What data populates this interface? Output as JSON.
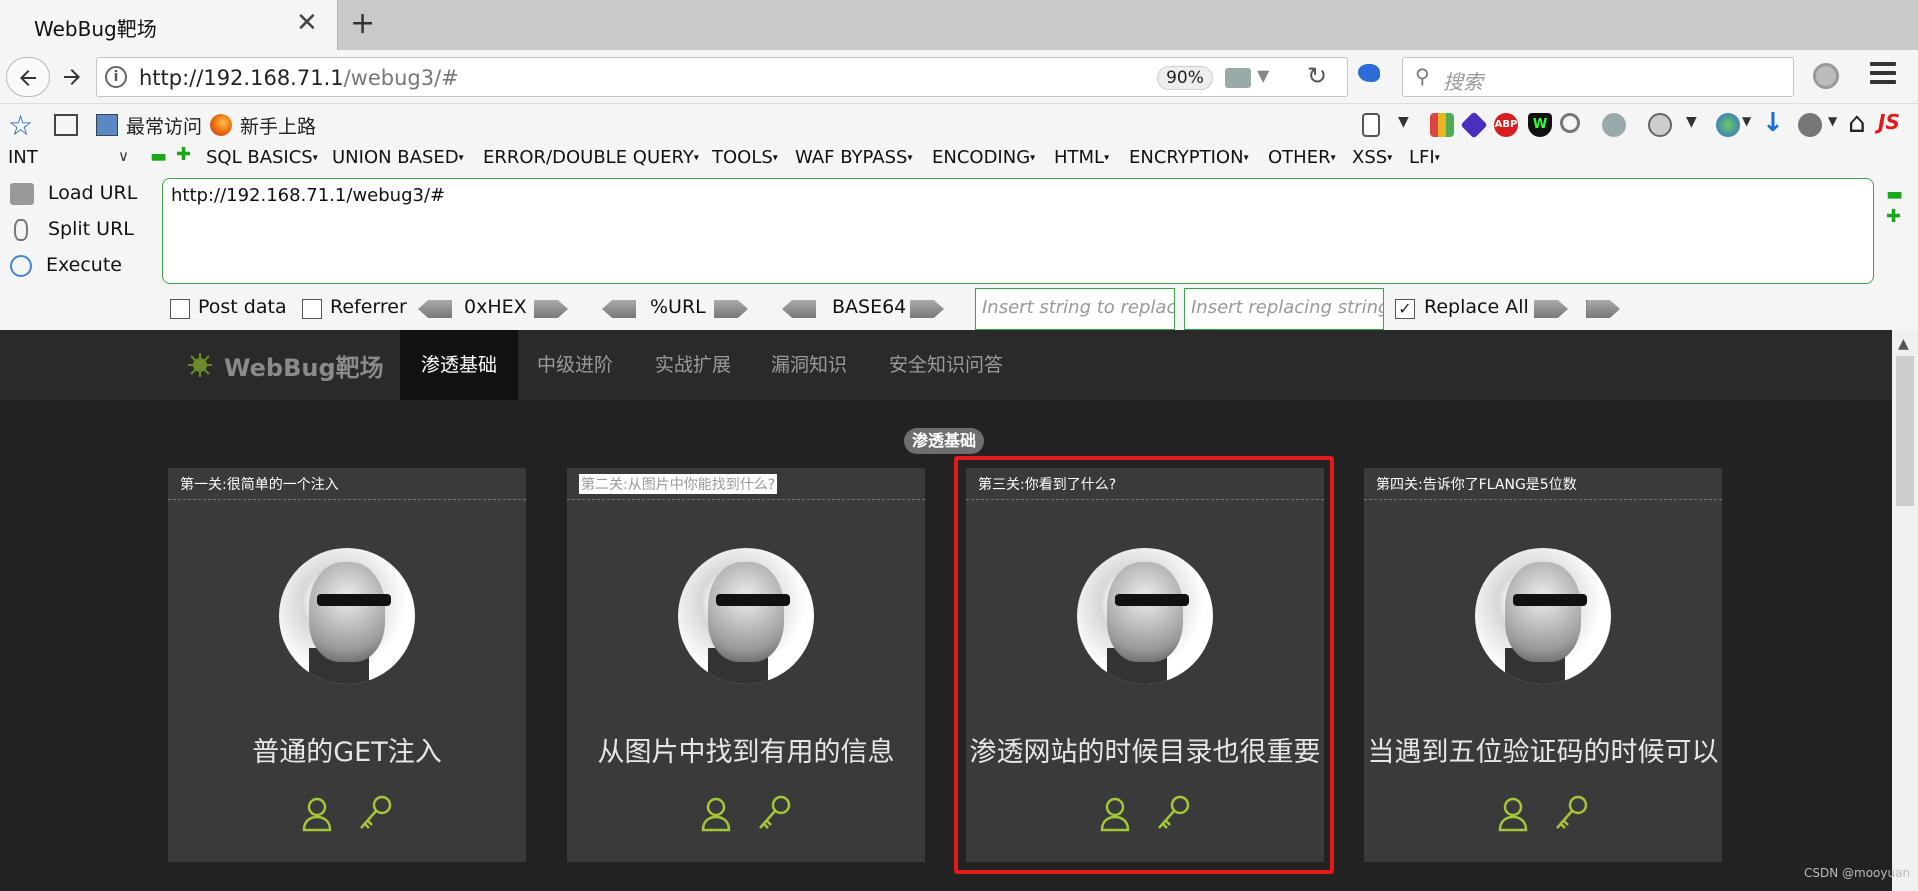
{
  "browser": {
    "tab_title": "WebBug靶场",
    "tab_close": "✕",
    "new_tab": "+",
    "url_host": "http://192.168.71.1",
    "url_path": "/webug3/#",
    "zoom": "90%",
    "search_placeholder": "搜索",
    "bookmarks": [
      "最常访问",
      "新手上路"
    ]
  },
  "hackbar": {
    "type_select": "INT",
    "menus": [
      "SQL BASICS",
      "UNION BASED",
      "ERROR/DOUBLE QUERY",
      "TOOLS",
      "WAF BYPASS",
      "ENCODING",
      "HTML",
      "ENCRYPTION",
      "OTHER",
      "XSS",
      "LFI"
    ],
    "side_buttons": [
      "Load URL",
      "Split URL",
      "Execute"
    ],
    "url_value": "http://192.168.71.1/webug3/#",
    "post_data_label": "Post data",
    "referrer_label": "Referrer",
    "encoders": [
      "0xHEX",
      "%URL",
      "BASE64"
    ],
    "replace_placeholder": "Insert string to replace",
    "replacing_placeholder": "Insert replacing string",
    "replace_all_label": "Replace All",
    "replace_all_checked": true
  },
  "site": {
    "logo": "WebBug靶场",
    "nav": [
      "渗透基础",
      "中级进阶",
      "实战扩展",
      "漏洞知识",
      "安全知识问答"
    ],
    "active_nav": "渗透基础",
    "section_badge": "渗透基础",
    "cards": [
      {
        "title": "第一关:很简单的一个注入",
        "caption": "普通的GET注入"
      },
      {
        "title": "第二关:从图片中你能找到什么?",
        "caption": "从图片中找到有用的信息"
      },
      {
        "title": "第三关:你看到了什么?",
        "caption": "渗透网站的时候目录也很重要"
      },
      {
        "title": "第四关:告诉你了FLANG是5位数",
        "caption": "当遇到五位验证码的时候可以"
      }
    ]
  },
  "watermark": "CSDN @mooyuan",
  "colors": {
    "accent_green": "#a4c639",
    "highlight_red": "#e21a1a",
    "hackbar_green": "#3aa64a"
  }
}
